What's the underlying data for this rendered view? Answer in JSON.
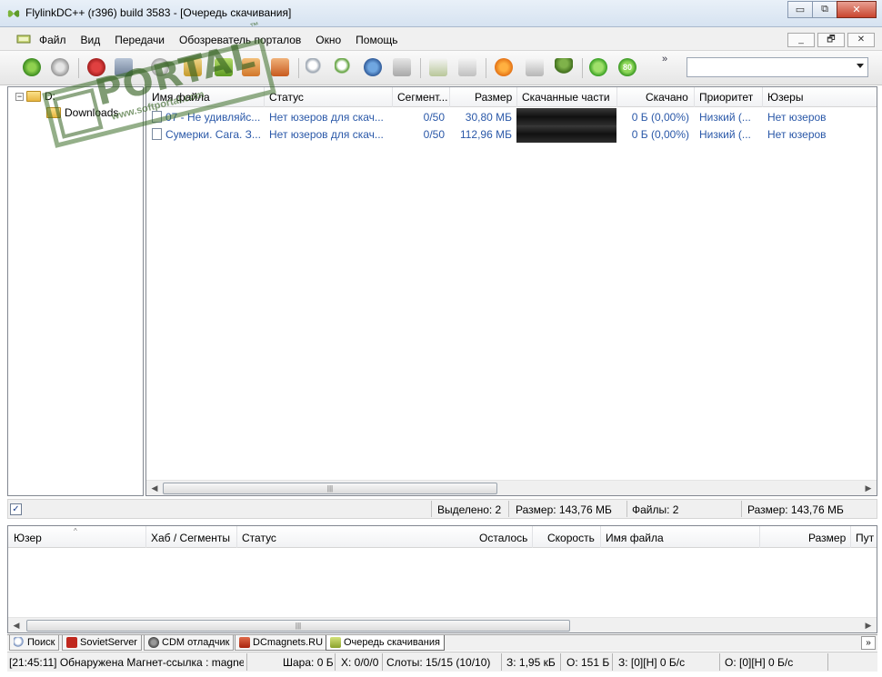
{
  "window": {
    "title": "FlylinkDC++ (r396) build 3583 - [Очередь скачивания]",
    "min_glyph": "▭",
    "max_glyph": "⧉",
    "close_glyph": "✕"
  },
  "menu": {
    "items": [
      "Файл",
      "Вид",
      "Передачи",
      "Обозреватель порталов",
      "Окно",
      "Помощь"
    ],
    "mdi_min": "_",
    "mdi_restore": "🗗",
    "mdi_close": "✕"
  },
  "toolbar": {
    "icons": [
      "reconnect-icon",
      "disk-icon",
      "favorites-heart-icon",
      "users-icon",
      "refresh-icon",
      "hashing-icon",
      "download-check-icon",
      "queue-icon",
      "finished-icon",
      "search-icon",
      "search-spy-icon",
      "network-stats-icon",
      "notepad-icon",
      "adl-search-icon",
      "upload-icon",
      "orange-globe-icon",
      "cleanup-icon",
      "user-green-icon",
      "power-icon",
      "limit-80-icon"
    ],
    "more_label": "»",
    "limit_badge": "80",
    "search_value": ""
  },
  "tree": {
    "root": "D:",
    "child": "Downloads"
  },
  "queue": {
    "columns": [
      "Имя файла",
      "Статус",
      "Сегмент...",
      "Размер",
      "Скачанные части",
      "Скачано",
      "Приоритет",
      "Юзеры"
    ],
    "rows": [
      {
        "name": "07 - Не удивляйс...",
        "status": "Нет юзеров для скач...",
        "segments": "0/50",
        "size": "30,80 МБ",
        "downloaded": "0 Б (0,00%)",
        "priority": "Низкий (...",
        "users": "Нет юзеров"
      },
      {
        "name": "Сумерки. Сага. З...",
        "status": "Нет юзеров для скач...",
        "segments": "0/50",
        "size": "112,96 МБ",
        "downloaded": "0 Б (0,00%)",
        "priority": "Низкий (...",
        "users": "Нет юзеров"
      }
    ]
  },
  "queue_status": {
    "checkbox": "✓",
    "selected": "Выделено: 2",
    "size_selected": "Размер: 143,76 МБ",
    "files": "Файлы: 2",
    "size_total": "Размер: 143,76 МБ"
  },
  "transfers": {
    "columns": [
      "Юзер",
      "Хаб / Сегменты",
      "Статус",
      "Осталось",
      "Скорость",
      "Имя файла",
      "Размер",
      "Пут"
    ]
  },
  "tabs": [
    {
      "label": "Поиск",
      "icon": "search-icon",
      "color": "#6a86b8"
    },
    {
      "label": "SovietServer",
      "icon": "soviet-flag-icon",
      "color": "#c0281e"
    },
    {
      "label": "CDM отладчик",
      "icon": "debug-icon",
      "color": "#5c5c5c"
    },
    {
      "label": "DCmagnets.RU",
      "icon": "magnet-icon",
      "color": "#c23a20"
    },
    {
      "label": "Очередь скачивания",
      "icon": "queue-icon",
      "color": "#9ab03c"
    }
  ],
  "tabs_more": "»",
  "statusbar": {
    "message": "[21:45:11] Обнаружена Магнет-ссылка : magne",
    "share": "Шара: 0 Б",
    "hubs": "X: 0/0/0",
    "slots": "Слоты: 15/15 (10/10)",
    "download": "З: 1,95 кБ",
    "upload": "О: 151 Б",
    "download_speed": "З: [0][Н] 0 Б/с",
    "upload_speed": "О: [0][Н] 0 Б/с"
  },
  "watermark": {
    "text": "PORTAL",
    "tm": "™",
    "url": "www.softportal.com"
  },
  "colors": {
    "accent": "#2a58a8",
    "watermark": "#3c6e28"
  }
}
